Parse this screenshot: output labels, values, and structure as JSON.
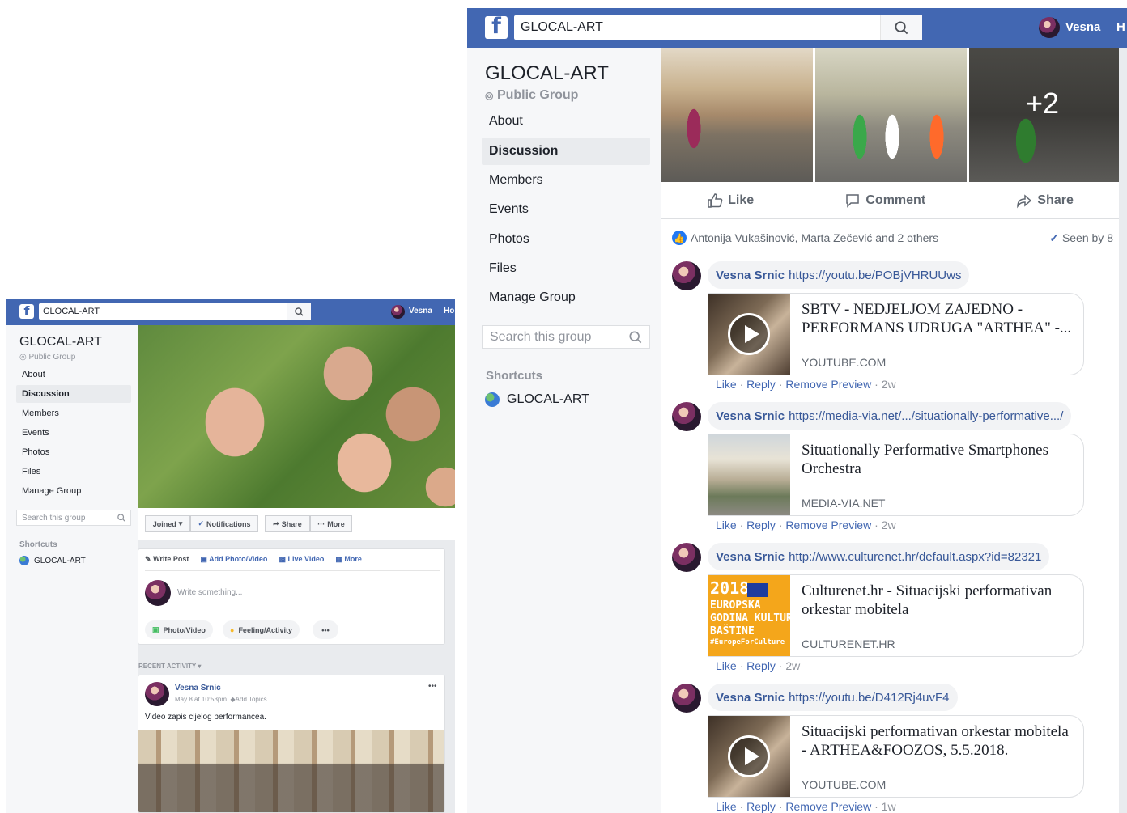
{
  "right": {
    "search_value": "GLOCAL-ART",
    "user_name": "Vesna",
    "user_cut": "H",
    "group_title": "GLOCAL-ART",
    "group_type": "Public Group",
    "nav": [
      "About",
      "Discussion",
      "Members",
      "Events",
      "Photos",
      "Files",
      "Manage Group"
    ],
    "active_nav": "Discussion",
    "search_group_placeholder": "Search this group",
    "shortcuts_title": "Shortcuts",
    "shortcut_item": "GLOCAL-ART",
    "photo_more": "+2",
    "actions": {
      "like": "Like",
      "comment": "Comment",
      "share": "Share"
    },
    "reactions": "Antonija Vukašinović, Marta Zečević and 2 others",
    "seen": "Seen by 8",
    "comments": [
      {
        "author": "Vesna Srnic",
        "text": "https://youtu.be/POBjVHRUUws",
        "preview_title": "SBTV - NEDJELJOM ZAJEDNO - PERFORMANS UDRUGA \"ARTHEA\" -...",
        "domain": "YOUTUBE.COM",
        "actions": [
          "Like",
          "Reply",
          "Remove Preview",
          "2w"
        ],
        "thumb": "video"
      },
      {
        "author": "Vesna Srnic",
        "text": "https://media-via.net/.../situationally-performative.../",
        "preview_title": "Situationally Performative Smartphones Orchestra",
        "domain": "MEDIA-VIA.NET",
        "actions": [
          "Like",
          "Reply",
          "Remove Preview",
          "2w"
        ],
        "thumb": "building"
      },
      {
        "author": "Vesna Srnic",
        "text": "http://www.culturenet.hr/default.aspx?id=82321",
        "preview_title": "Culturenet.hr - Situacijski performativan orkestar mobitela",
        "domain": "CULTURENET.HR",
        "actions": [
          "Like",
          "Reply",
          "2w"
        ],
        "thumb": "eu",
        "eu_lines": [
          "2018.",
          "EUROPSKA",
          "GODINA KULTURNE",
          "BAŠTINE",
          "#EuropeForCulture"
        ]
      },
      {
        "author": "Vesna Srnic",
        "text": "https://youtu.be/D412Rj4uvF4",
        "preview_title": "Situacijski performativan orkestar mobitela - ARTHEA&FOOZOS, 5.5.2018.",
        "domain": "YOUTUBE.COM",
        "actions": [
          "Like",
          "Reply",
          "Remove Preview",
          "1w"
        ],
        "thumb": "video"
      }
    ]
  },
  "left": {
    "search_value": "GLOCAL-ART",
    "user_name": "Vesna",
    "user_cut": "Ho",
    "group_title": "GLOCAL-ART",
    "group_type": "Public Group",
    "nav": [
      "About",
      "Discussion",
      "Members",
      "Events",
      "Photos",
      "Files",
      "Manage Group"
    ],
    "search_group_placeholder": "Search this group",
    "shortcuts_title": "Shortcuts",
    "shortcut_item": "GLOCAL-ART",
    "cover_buttons": [
      "Joined",
      "Notifications",
      "Share",
      "More"
    ],
    "composer_tabs": [
      "Write Post",
      "Add Photo/Video",
      "Live Video",
      "More"
    ],
    "composer_placeholder": "Write something...",
    "composer_actions": [
      "Photo/Video",
      "Feeling/Activity",
      "•••"
    ],
    "recent_activity": "RECENT ACTIVITY",
    "post": {
      "author": "Vesna Srnic",
      "meta": "May 8 at 10:53pm",
      "topics": "Add Topics",
      "text": "Video zapis cijelog performancea.",
      "more": "•••"
    }
  },
  "colors": {
    "fb_blue": "#4267b2",
    "link_blue": "#385898",
    "page_bg": "#e9ebee",
    "sidebar_bg": "#f6f7f9"
  }
}
